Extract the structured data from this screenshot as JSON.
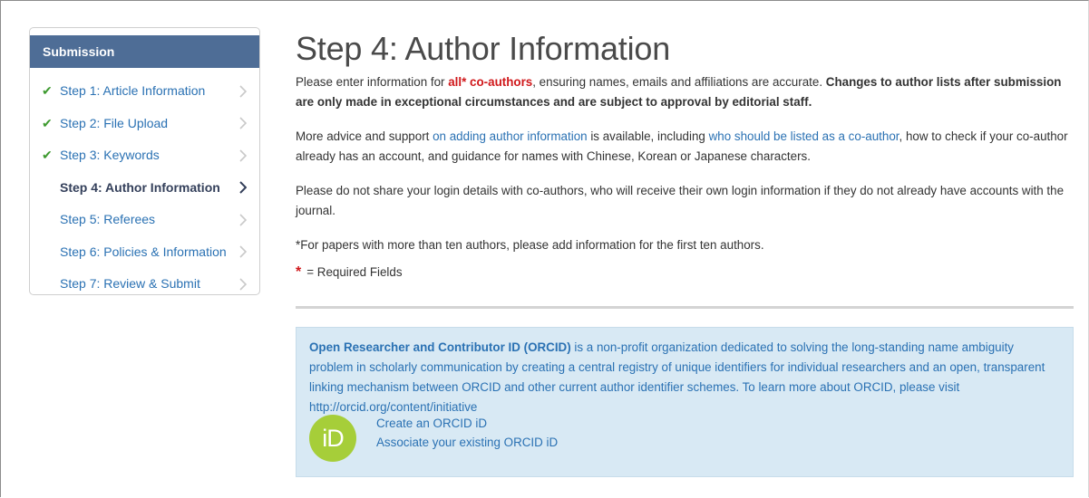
{
  "sidebar": {
    "header": "Submission",
    "items": [
      {
        "label": "Step 1: Article Information",
        "done": true
      },
      {
        "label": "Step 2: File Upload",
        "done": true
      },
      {
        "label": "Step 3: Keywords",
        "done": true
      },
      {
        "label": "Step 4: Author Information",
        "done": false,
        "current": true
      },
      {
        "label": "Step 5: Referees",
        "done": false
      },
      {
        "label": "Step 6: Policies & Information",
        "done": false
      },
      {
        "label": "Step 7: Review & Submit",
        "done": false
      }
    ]
  },
  "main": {
    "title": "Step 4: Author Information",
    "p1": {
      "a": "Please enter information for ",
      "b": "all* co-authors",
      "c": ", ensuring names, emails and affiliations are accurate. ",
      "d": "Changes to author lists after submission are only made in exceptional circumstances and are subject to approval by editorial staff."
    },
    "p2": {
      "a": "More advice and support ",
      "link1": "on adding author information",
      "b": " is available, including ",
      "link2": "who should be listed as a co-author",
      "c": ", how to check if your co-author already has an account, and guidance for names with Chinese, Korean or Japanese characters."
    },
    "p3": "Please do not share your login details with co-authors, who will receive their own login information if they do not already have accounts with the journal.",
    "p4": "*For papers with more than ten authors, please add information for the first ten authors.",
    "required_star": "*",
    "required_text": "= Required Fields"
  },
  "orcid": {
    "bold": "Open Researcher and Contributor ID (ORCID)",
    "text": " is a non-profit organization dedicated to solving the long-standing name ambiguity problem in scholarly communication by creating a central registry of unique identifiers for individual researchers and an open, transparent linking mechanism between ORCID and other current author identifier schemes. To learn more about ORCID, please visit http://orcid.org/content/initiative",
    "logo": "iD",
    "create_link": "Create an ORCID iD",
    "associate_link": "Associate your existing ORCID iD"
  },
  "colors": {
    "header_bg": "#4e6d96",
    "link": "#2a71b3",
    "check": "#3d9a2f",
    "required": "#d0181b",
    "orcid_box": "#d8e9f4",
    "orcid_logo": "#a6ce39"
  },
  "icons": {
    "check": "check-icon",
    "chevron": "chevron-right-icon"
  }
}
